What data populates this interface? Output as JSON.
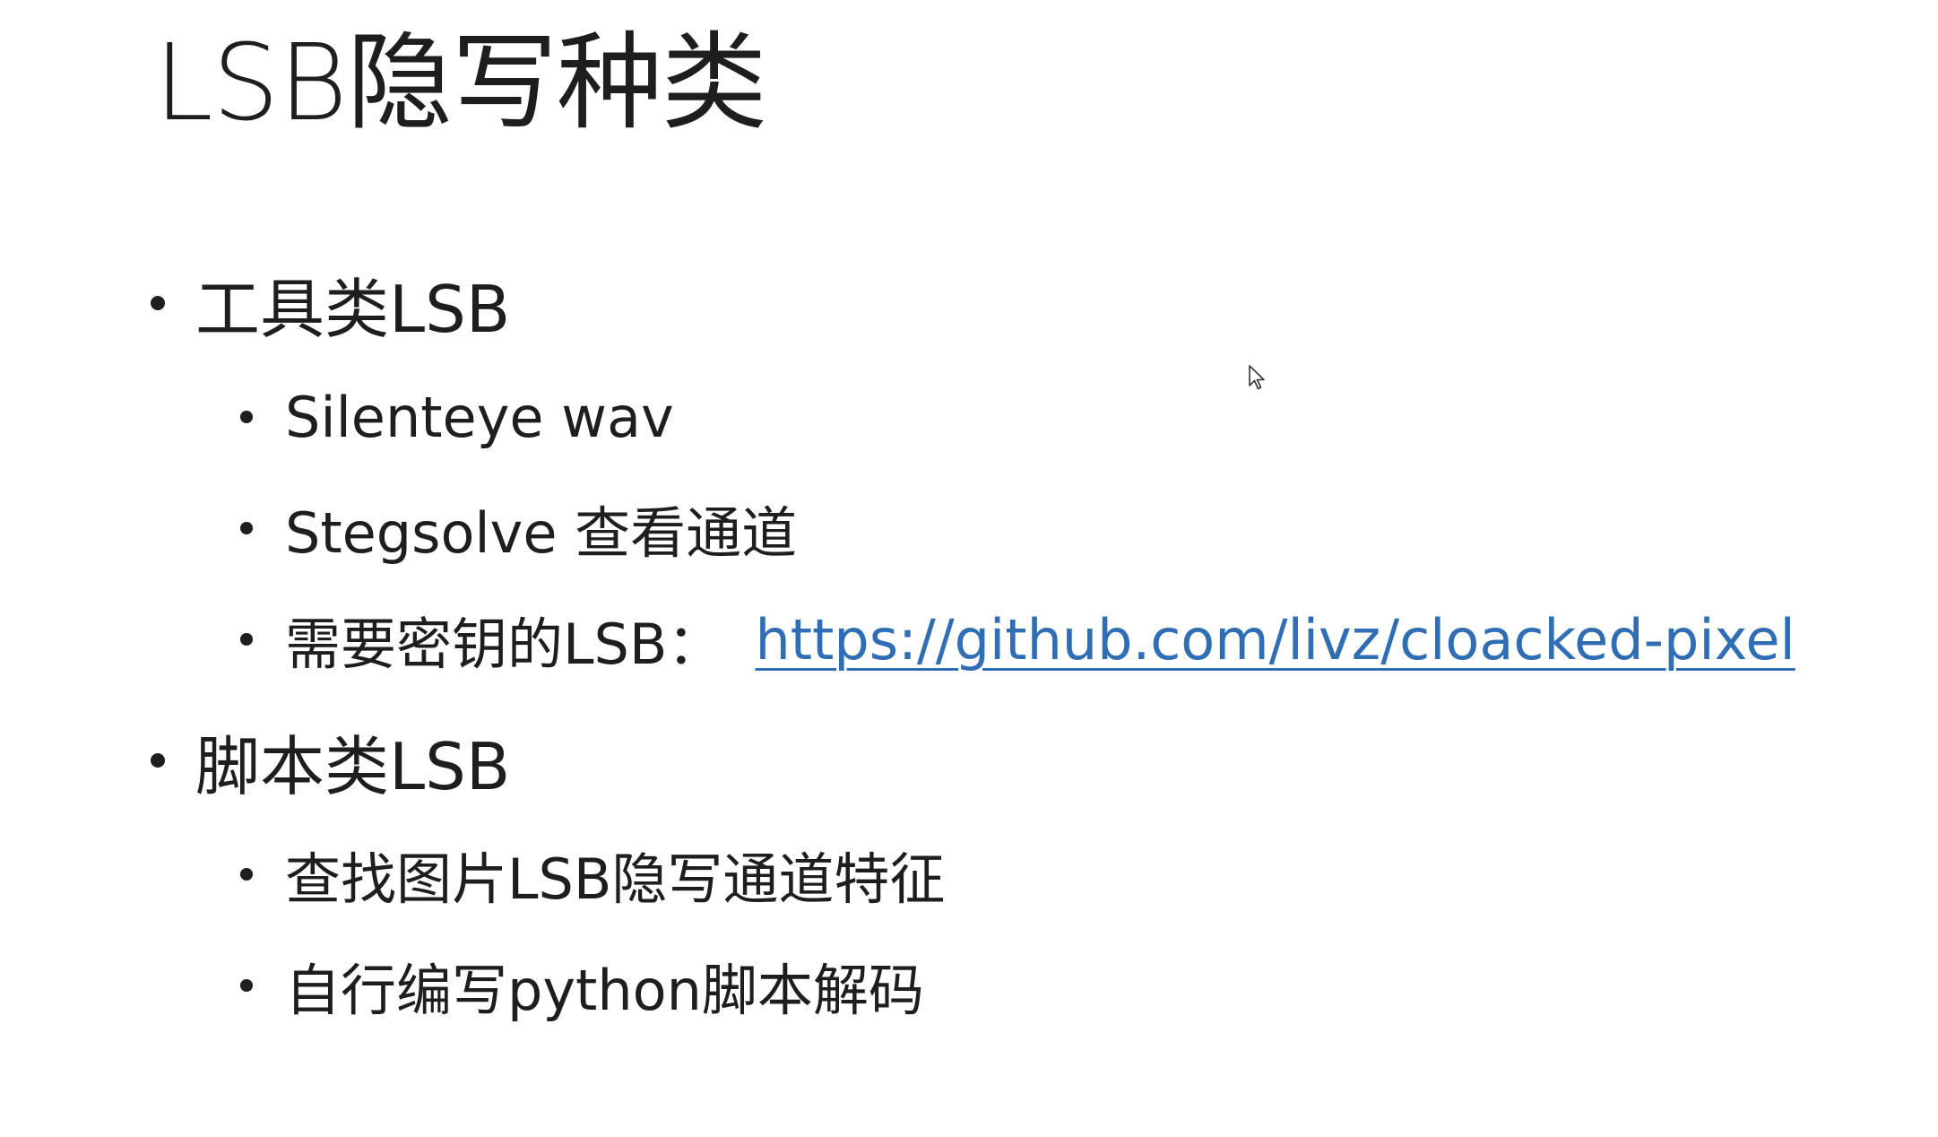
{
  "slide": {
    "title": "LSB隐写种类",
    "sections": [
      {
        "label": "工具类LSB",
        "items": [
          {
            "label": "Silenteye wav"
          },
          {
            "label": "Stegsolve 查看通道"
          },
          {
            "label": "需要密钥的LSB：",
            "link": "https://github.com/livz/cloacked-pixel"
          }
        ]
      },
      {
        "label": "脚本类LSB",
        "items": [
          {
            "label": "查找图片LSB隐写通道特征"
          },
          {
            "label": "自行编写python脚本解码"
          }
        ]
      }
    ]
  },
  "colors": {
    "text": "#1e1e1e",
    "link": "#2f6db5",
    "background": "#ffffff"
  },
  "icons": {
    "pointer": "mouse-pointer-icon"
  }
}
